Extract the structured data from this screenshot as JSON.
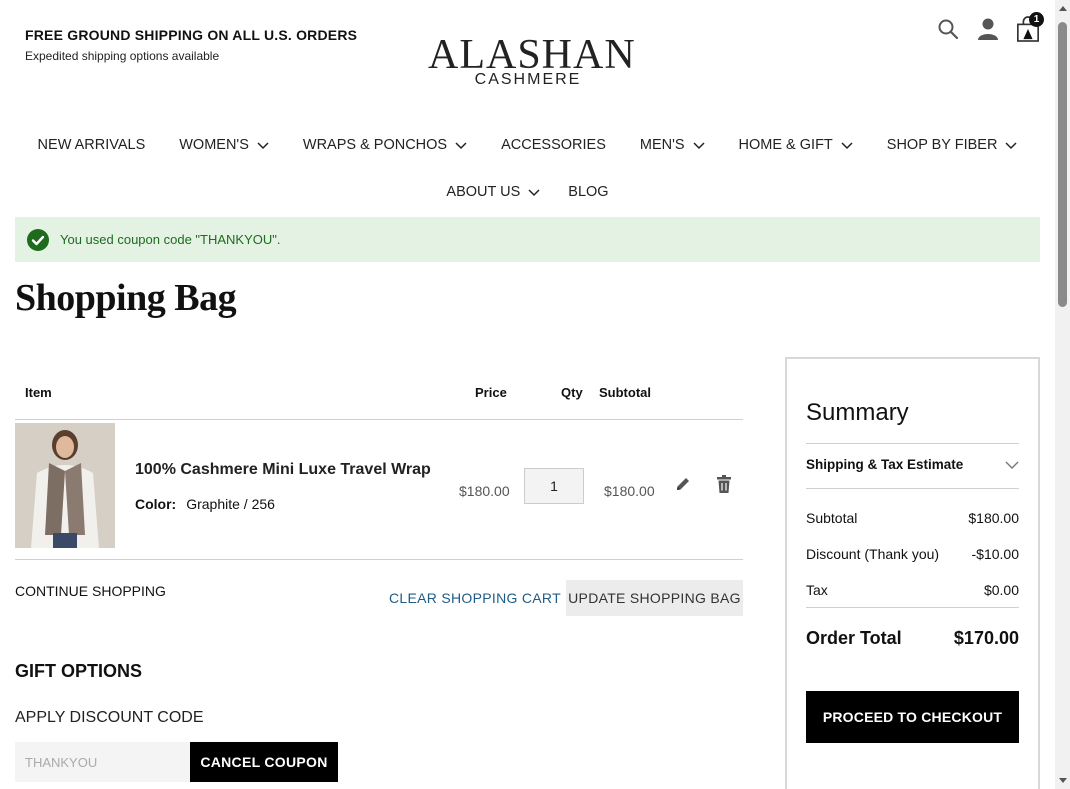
{
  "header": {
    "promo_title": "FREE GROUND SHIPPING ON ALL U.S. ORDERS",
    "promo_sub": "Expedited shipping options available",
    "logo_main": "ALASHAN",
    "logo_sub": "CASHMERE",
    "cart_count": "1",
    "icons": [
      "search-icon",
      "account-icon",
      "cart-icon"
    ]
  },
  "nav": {
    "row1": [
      {
        "label": "NEW ARRIVALS",
        "dropdown": false
      },
      {
        "label": "WOMEN'S",
        "dropdown": true
      },
      {
        "label": "WRAPS & PONCHOS",
        "dropdown": true
      },
      {
        "label": "ACCESSORIES",
        "dropdown": false
      },
      {
        "label": "MEN'S",
        "dropdown": true
      },
      {
        "label": "HOME & GIFT",
        "dropdown": true
      },
      {
        "label": "SHOP BY FIBER",
        "dropdown": true
      }
    ],
    "row2": [
      {
        "label": "ABOUT US",
        "dropdown": true
      },
      {
        "label": "BLOG",
        "dropdown": false
      }
    ]
  },
  "message": {
    "text": "You used coupon code \"THANKYOU\".",
    "color": "#1e6b1e"
  },
  "page_title": "Shopping Bag",
  "cart": {
    "headers": {
      "item": "Item",
      "price": "Price",
      "qty": "Qty",
      "subtotal": "Subtotal"
    },
    "items": [
      {
        "name": "100% Cashmere Mini Luxe Travel Wrap",
        "option_label": "Color:",
        "option_value": "Graphite / 256",
        "price": "$180.00",
        "qty": "1",
        "subtotal": "$180.00"
      }
    ],
    "continue_label": "CONTINUE SHOPPING",
    "clear_label": "CLEAR SHOPPING CART",
    "update_label": "UPDATE SHOPPING BAG"
  },
  "gift": {
    "title": "GIFT OPTIONS"
  },
  "discount": {
    "title": "APPLY DISCOUNT CODE",
    "code_value": "THANKYOU",
    "cancel_label": "CANCEL COUPON"
  },
  "summary": {
    "title": "Summary",
    "shipping_label": "Shipping & Tax Estimate",
    "subtotal_label": "Subtotal",
    "subtotal_value": "$180.00",
    "discount_label": "Discount (Thank you)",
    "discount_value": "-$10.00",
    "tax_label": "Tax",
    "tax_value": "$0.00",
    "total_label": "Order Total",
    "total_value": "$170.00",
    "checkout_label": "PROCEED TO CHECKOUT"
  },
  "colors": {
    "accent": "#000000",
    "success_bg": "#e4f2e4",
    "link": "#1f5c85"
  }
}
